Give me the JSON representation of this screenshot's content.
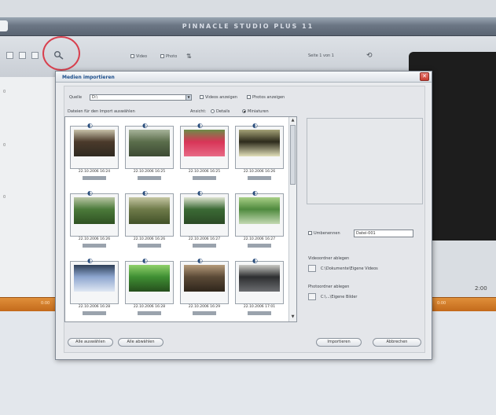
{
  "app": {
    "title": "PINNACLE STUDIO PLUS 11"
  },
  "toolbar": {
    "option_video": "Video",
    "option_photo": "Photo",
    "page_info": "Seite 1 von 1"
  },
  "left_panel": {
    "ticks": [
      "0",
      "0",
      "0"
    ]
  },
  "timeline": {
    "markers": [
      "0:00",
      "0:00"
    ],
    "counter": "2:00"
  },
  "dialog": {
    "title": "Medien importieren",
    "source_label": "Quelle",
    "source_value": "D:\\",
    "show_videos_label": "Videos anzeigen",
    "show_photos_label": "Photos anzeigen",
    "select_instruction": "Dateien für den Import auswählen",
    "view_label": "Ansicht:",
    "view_option_details": "Details",
    "view_option_thumbnails": "Miniaturen",
    "rename_label": "Umbenennen",
    "rename_value": "Datei-001",
    "video_folder_label": "Videoordner ablegen",
    "video_folder_path": "C:\\Dokumente\\Eigene Videos",
    "photo_folder_label": "Photoordner ablegen",
    "photo_folder_path": "C:\\...\\Eigene Bilder",
    "select_all_button": "Alle auswählen",
    "deselect_all_button": "Alle abwählen",
    "import_button": "Importieren",
    "cancel_button": "Abbrechen"
  },
  "thumbnails": [
    {
      "date": "22.10.2006 16:24",
      "palette": [
        "#4b3a2b",
        "#c7c1a9",
        "#2f2a21"
      ]
    },
    {
      "date": "22.10.2006 16:25",
      "palette": [
        "#5b6e4c",
        "#a7b39a",
        "#3c4a33"
      ]
    },
    {
      "date": "22.10.2006 16:25",
      "palette": [
        "#d83557",
        "#6c8c47",
        "#e76a86"
      ]
    },
    {
      "date": "22.10.2006 16:26",
      "palette": [
        "#2d2b1c",
        "#a4a277",
        "#e1dfb9"
      ]
    },
    {
      "date": "22.10.2006 16:26",
      "palette": [
        "#4b7a3a",
        "#b9c6a4",
        "#2f5122"
      ]
    },
    {
      "date": "22.10.2006 16:26",
      "palette": [
        "#6f7b4a",
        "#c5c6a3",
        "#415128"
      ]
    },
    {
      "date": "22.10.2006 16:27",
      "palette": [
        "#3b6a35",
        "#dde3d0",
        "#2b4a25"
      ]
    },
    {
      "date": "22.10.2006 16:27",
      "palette": [
        "#4f8a3e",
        "#a8cf86",
        "#c3d9b2"
      ]
    },
    {
      "date": "22.10.2006 16:28",
      "palette": [
        "#8da6cf",
        "#2e3f57",
        "#dfe7f3"
      ]
    },
    {
      "date": "22.10.2006 16:28",
      "palette": [
        "#3f8f33",
        "#8fd06a",
        "#264f1d"
      ]
    },
    {
      "date": "22.10.2006 16:29",
      "palette": [
        "#5b4a37",
        "#b59b7a",
        "#2f261b"
      ]
    },
    {
      "date": "22.10.2006 17:01",
      "palette": [
        "#2e2f31",
        "#c9c9c4",
        "#6b6d70"
      ]
    }
  ],
  "colors": {
    "accent": "#3a67a8",
    "highlight_circle": "#d8404e",
    "timeline": "#d27c2b"
  }
}
